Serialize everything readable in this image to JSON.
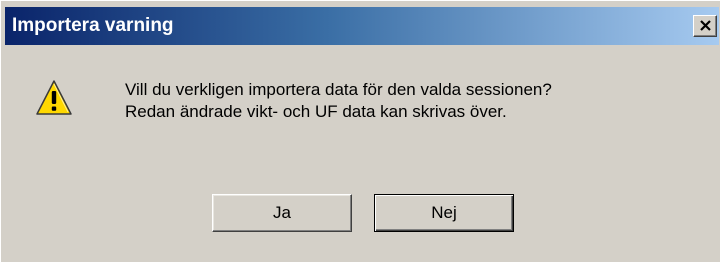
{
  "dialog": {
    "title": "Importera varning",
    "close_icon": "close-icon",
    "message_icon": "warning-icon",
    "message_line1": "Vill du verkligen importera data för den valda sessionen?",
    "message_line2": "Redan ändrade vikt- och UF data kan skrivas över.",
    "buttons": {
      "yes_label": "Ja",
      "no_label": "Nej",
      "default": "Nej"
    },
    "colors": {
      "titlebar_start": "#0a246a",
      "titlebar_end": "#a6caf0",
      "face": "#d4d0c8",
      "warning_fill": "#ffd800"
    }
  }
}
